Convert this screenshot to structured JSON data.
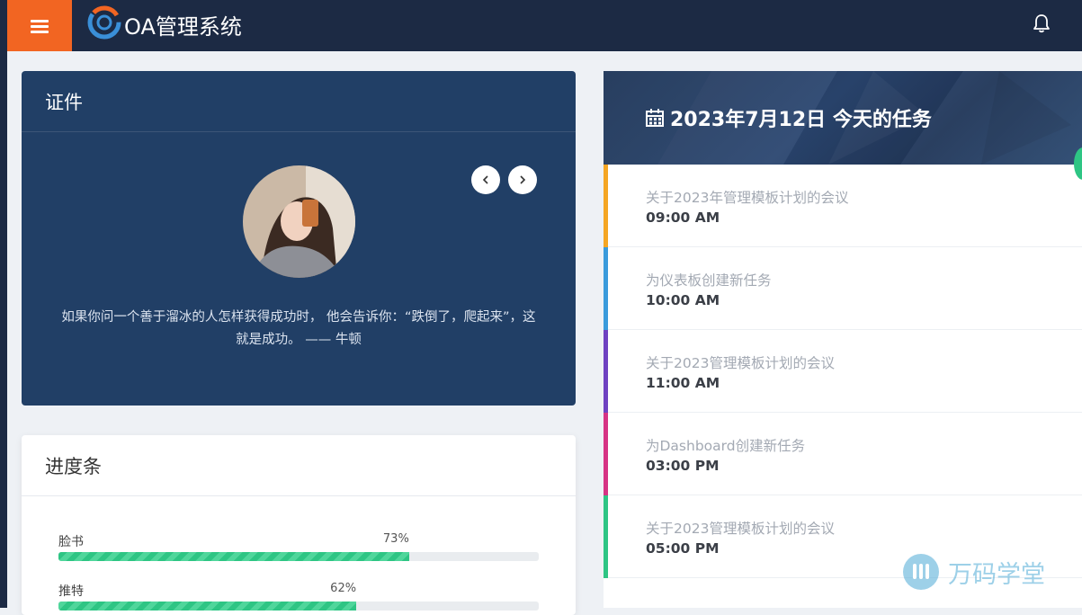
{
  "header": {
    "title": "OA管理系统",
    "menu_icon": "hamburger-menu-icon",
    "logo_icon": "oa-logo-icon",
    "bell_icon": "bell-icon",
    "accent": "#f26522",
    "bg": "#1c2a44"
  },
  "certificate": {
    "title": "证件",
    "quote": "如果你问一个善于溜冰的人怎样获得成功时， 他会告诉你：“跌倒了，爬起来”，这就是成功。 —— 牛顿",
    "prev_icon": "chevron-left-icon",
    "next_icon": "chevron-right-icon"
  },
  "progress": {
    "title": "进度条",
    "items": [
      {
        "label": "脸书",
        "percent_text": "73%",
        "value": 73
      },
      {
        "label": "推特",
        "percent_text": "62%",
        "value": 62
      }
    ],
    "bar_color": "#2ec584"
  },
  "tasks": {
    "title": "2023年7月12日 今天的任务",
    "calendar_icon": "calendar-icon",
    "items": [
      {
        "name": "关于2023年管理模板计划的会议",
        "time": "09:00 AM",
        "color": "#f5a623"
      },
      {
        "name": "为仪表板创建新任务",
        "time": "10:00 AM",
        "color": "#3a9bdc"
      },
      {
        "name": "关于2023管理模板计划的会议",
        "time": "11:00 AM",
        "color": "#6f42c1"
      },
      {
        "name": "为Dashboard创建新任务",
        "time": "03:00 PM",
        "color": "#d63384"
      },
      {
        "name": "关于2023管理模板计划的会议",
        "time": "05:00 PM",
        "color": "#2ec584"
      }
    ]
  },
  "watermark": {
    "text": "万码学堂",
    "icon": "wanma-logo-icon"
  }
}
